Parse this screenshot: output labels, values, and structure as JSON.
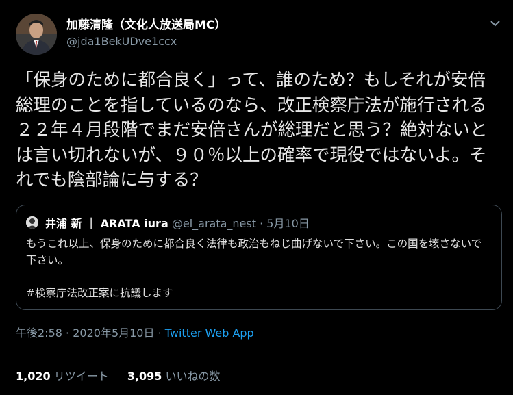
{
  "author": {
    "name": "加藤清隆（文化人放送局MC）",
    "handle": "@jda1BekUDve1ccx"
  },
  "tweet": {
    "text": "「保身のために都合良く」って、誰のため？もしそれが安倍総理のことを指しているのなら、改正検察庁法が施行される２２年４月段階でまだ安倍さんが総理だと思う？絶対ないとは言い切れないが、９０％以上の確率で現役ではないよ。それでも陰部論に与する？"
  },
  "quote": {
    "name": "井浦 新 ｜ ARATA iura",
    "handle": "@el_arata_nest",
    "separator": "·",
    "date": "5月10日",
    "text": "もうこれ以上、保身のために都合良く法律も政治もねじ曲げないで下さい。この国を壊さないで下さい。\n\n#検察庁法改正案に抗議します"
  },
  "meta": {
    "time": "午後2:58",
    "separator1": "·",
    "date": "2020年5月10日",
    "separator2": "·",
    "app": "Twitter Web App"
  },
  "stats": {
    "retweets_count": "1,020",
    "retweets_label": "リツイート",
    "likes_count": "3,095",
    "likes_label": "いいねの数"
  },
  "icons": {
    "caret": "chevron-down-icon"
  },
  "colors": {
    "background": "#000000",
    "link": "#1da1f2",
    "secondary": "#8899a6",
    "border": "#3d4852"
  }
}
